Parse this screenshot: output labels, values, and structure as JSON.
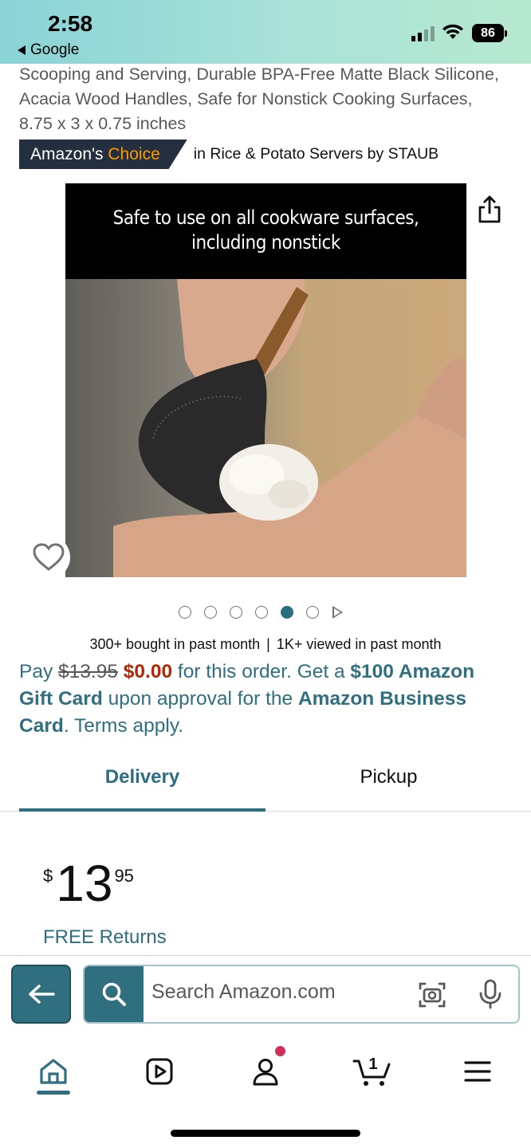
{
  "status_bar": {
    "time": "2:58",
    "back_app": "Google",
    "battery": "86"
  },
  "product": {
    "title_partial": "Scooping and Serving, Durable BPA-Free Matte Black Silicone, Acacia Wood Handles, Safe for Nonstick Cooking Surfaces, 8.75 x 3 x 0.75 inches",
    "badge_prefix": "Amazon's ",
    "badge_highlight": "Choice",
    "badge_category": "in Rice & Potato Servers by STAUB",
    "image_banner_line1": "Safe to use on all cookware surfaces,",
    "image_banner_line2": "including nonstick",
    "carousel_total": 6,
    "carousel_active": 5
  },
  "social_proof": {
    "bought": "300+ bought in past month",
    "separator": "|",
    "viewed": "1K+ viewed in past month"
  },
  "promo": {
    "pay": "Pay ",
    "original_price": "$13.95",
    "new_price": "$0.00",
    "mid": " for this order. Get a ",
    "gift": "$100 Amazon Gift Card",
    "upon": " upon approval for the ",
    "card": "Amazon Business Card",
    "end": ". Terms apply."
  },
  "tabs": {
    "delivery": "Delivery",
    "pickup": "Pickup"
  },
  "price": {
    "symbol": "$",
    "whole": "13",
    "fraction": "95"
  },
  "free_returns": "FREE Returns",
  "search": {
    "placeholder": "Search Amazon.com"
  },
  "colors": {
    "accent": "#2f6f7f",
    "deal_red": "#b12704",
    "badge_bg": "#232f3e",
    "badge_orange": "#ff9900"
  },
  "icons": {
    "share": "share-icon",
    "heart": "heart-icon",
    "back": "arrow-left-icon",
    "search": "search-icon",
    "camera": "camera-icon",
    "mic": "mic-icon",
    "home": "home-icon",
    "video": "video-icon",
    "account": "account-icon",
    "cart": "cart-icon",
    "menu": "menu-icon"
  },
  "cart_count": "1"
}
